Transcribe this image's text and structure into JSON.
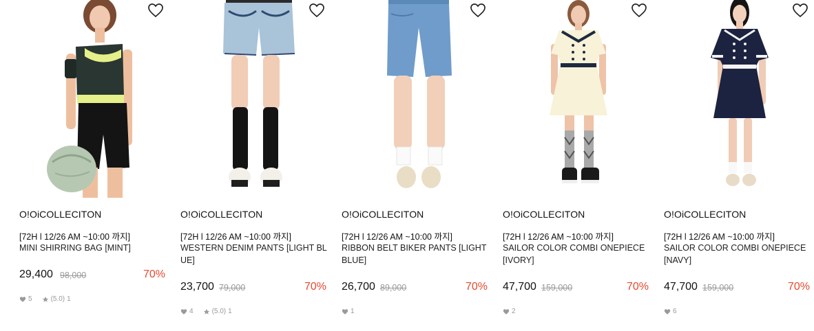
{
  "colors": {
    "accent": "#e8482e",
    "muted": "#999999",
    "text": "#222222"
  },
  "products": [
    {
      "brand": "O!OiCOLLECITON",
      "promo": "[72H l 12/26 AM ~10:00 까지]",
      "name": "MINI SHIRRING BAG [MINT]",
      "price": "29,400",
      "original_price": "98,000",
      "discount": "70%",
      "likes": "5",
      "rating": "(5.0)",
      "reviews": "1",
      "icons": [
        "heart-outline-icon",
        "heart-icon",
        "star-icon"
      ]
    },
    {
      "brand": "O!OiCOLLECITON",
      "promo": "[72H l 12/26 AM ~10:00 까지]",
      "name": "WESTERN DENIM PANTS [LIGHT BLUE]",
      "price": "23,700",
      "original_price": "79,000",
      "discount": "70%",
      "likes": "4",
      "rating": "(5.0)",
      "reviews": "1"
    },
    {
      "brand": "O!OiCOLLECITON",
      "promo": "[72H l 12/26 AM ~10:00 까지]",
      "name": "RIBBON BELT BIKER PANTS [LIGHT BLUE]",
      "price": "26,700",
      "original_price": "89,000",
      "discount": "70%",
      "likes": "1"
    },
    {
      "brand": "O!OiCOLLECITON",
      "promo": "[72H l 12/26 AM ~10:00 까지]",
      "name": "SAILOR COLOR COMBI ONEPIECE [IVORY]",
      "price": "47,700",
      "original_price": "159,000",
      "discount": "70%",
      "likes": "2"
    },
    {
      "brand": "O!OiCOLLECITON",
      "promo": "[72H l 12/26 AM ~10:00 까지]",
      "name": "SAILOR COLOR COMBI ONEPIECE [NAVY]",
      "price": "47,700",
      "original_price": "159,000",
      "discount": "70%",
      "likes": "6"
    }
  ]
}
